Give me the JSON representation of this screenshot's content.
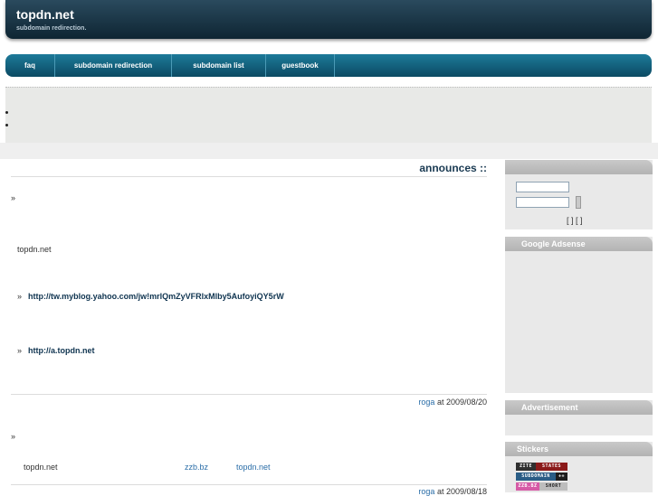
{
  "header": {
    "title": "topdn.net",
    "tagline": "subdomain redirection."
  },
  "nav": {
    "items": [
      {
        "label": "faq"
      },
      {
        "label": "subdomain redirection"
      },
      {
        "label": "subdomain list"
      },
      {
        "label": "guestbook"
      }
    ]
  },
  "announces": {
    "title": "announces ::",
    "arrow": "»",
    "posts": [
      {
        "line1": "topdn.net",
        "link1": "http://tw.myblog.yahoo.com/jw!mrlQmZyVFRlxMlby5AufoyiQY5rW",
        "link2": "http://a.topdn.net",
        "author": "roga",
        "date_text": " at 2009/08/20"
      },
      {
        "line1": "topdn.net",
        "link_mid": "zzb.bz",
        "link_end": "topdn.net",
        "author": "roga",
        "date_text": " at 2009/08/18"
      }
    ]
  },
  "sidebar": {
    "login": {
      "brackets": "[ ] [  ]"
    },
    "adsense_title": "Google Adsense",
    "advertisement_title": "Advertisement",
    "stickers_title": "Stickers",
    "stickers": [
      {
        "left": "ZITE",
        "right": "STATES",
        "left_color": "#2f2f2f",
        "right_color": "#8b1a1a"
      },
      {
        "left": "SUBDOMAIN",
        "right": "++",
        "left_color": "#2a5d86",
        "right_color": "#1e1e1e"
      },
      {
        "left": "ZZB.BZ",
        "right": "SHORT",
        "left_color": "#d65aa6",
        "right_color": "#bdbdbd"
      }
    ]
  }
}
